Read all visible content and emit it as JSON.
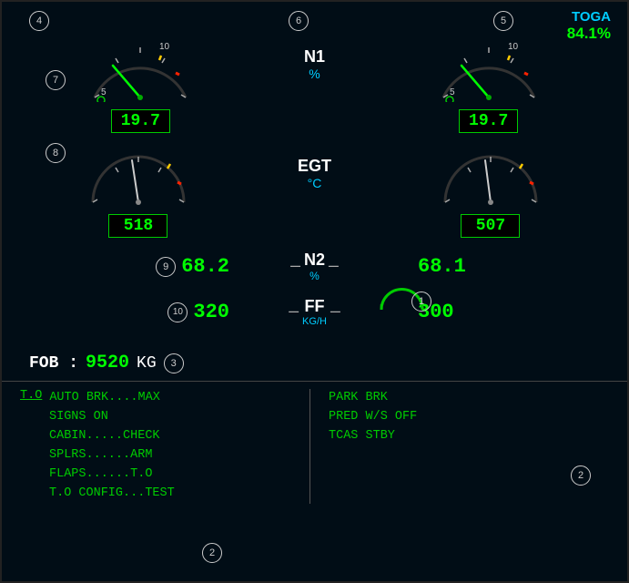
{
  "panel": {
    "background": "#010d16"
  },
  "toga": {
    "label": "TOGA",
    "value": "84.1%"
  },
  "circle_labels": {
    "c4": "4",
    "c5": "5",
    "c6": "6",
    "c7": "7",
    "c8": "8",
    "c9": "9",
    "c10": "10",
    "c1": "1",
    "c2_left": "2",
    "c2_right": "2",
    "c3": "3"
  },
  "n1": {
    "label": "N1",
    "unit": "%",
    "left_value": "19.7",
    "right_value": "19.7"
  },
  "egt": {
    "label": "EGT",
    "unit": "°C",
    "left_value": "518",
    "right_value": "507"
  },
  "n2": {
    "label": "N2",
    "unit": "%",
    "left_value": "68.2",
    "right_value": "68.1"
  },
  "ff": {
    "label": "FF",
    "unit": "KG/H",
    "left_value": "320",
    "right_value": "300"
  },
  "fob": {
    "label": "FOB :",
    "value": "9520",
    "unit": "KG"
  },
  "checklist_left": {
    "header": "T.O",
    "items": [
      "AUTO BRK....MAX",
      "SIGNS ON",
      "CABIN.....CHECK",
      "SPLRS......ARM",
      "FLAPS......T.O",
      "T.O CONFIG...TEST"
    ]
  },
  "checklist_right": {
    "items": [
      "PARK BRK",
      "PRED W/S OFF",
      "TCAS STBY"
    ]
  }
}
